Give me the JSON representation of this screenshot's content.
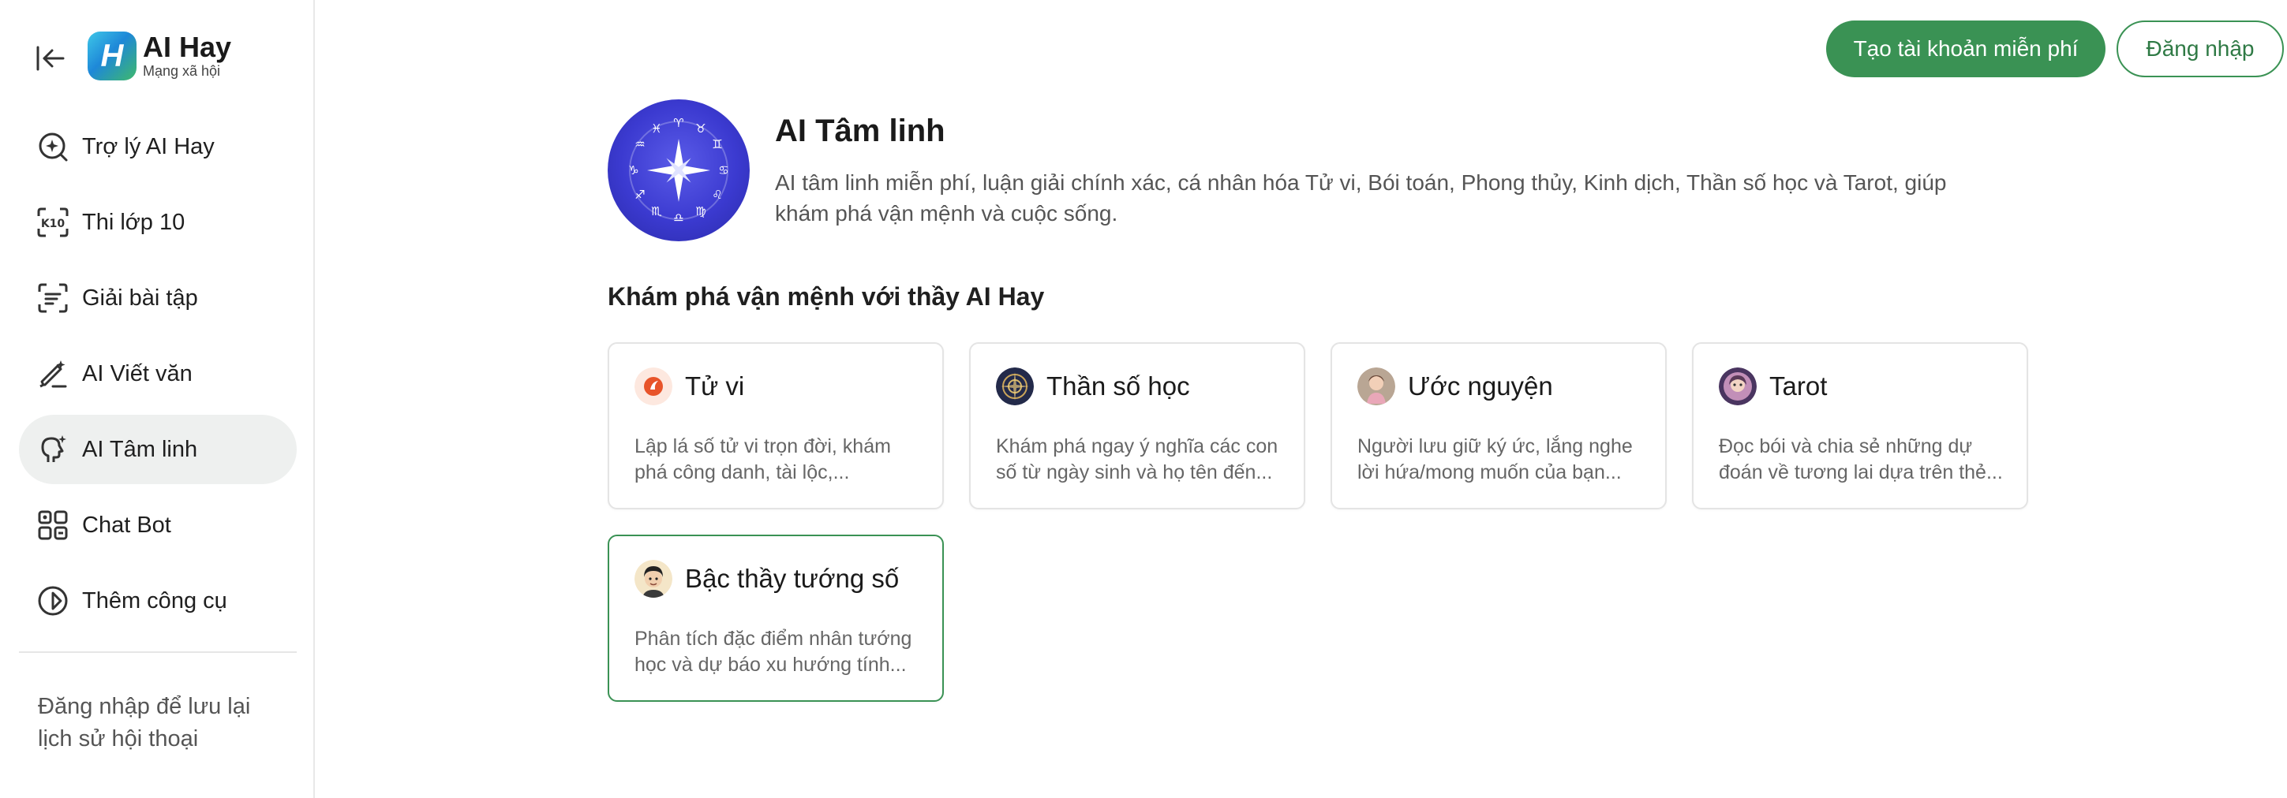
{
  "brand": {
    "name": "AI Hay",
    "tagline": "Mạng xã hội",
    "logo_letter": "H"
  },
  "sidebar": {
    "items": [
      {
        "label": "Trợ lý AI Hay",
        "icon": "ai-assistant-icon",
        "active": false
      },
      {
        "label": "Thi lớp 10",
        "icon": "k10-exam-icon",
        "active": false
      },
      {
        "label": "Giải bài tập",
        "icon": "homework-scan-icon",
        "active": false
      },
      {
        "label": "AI Viết văn",
        "icon": "pen-sparkle-icon",
        "active": false
      },
      {
        "label": "AI Tâm linh",
        "icon": "spiritual-icon",
        "active": true
      },
      {
        "label": "Chat Bot",
        "icon": "apps-grid-icon",
        "active": false
      },
      {
        "label": "Thêm công cụ",
        "icon": "compass-icon",
        "active": false
      }
    ],
    "login_note": "Đăng nhập để lưu lại lịch sử hội thoại"
  },
  "header": {
    "signup_label": "Tạo tài khoản miễn phí",
    "login_label": "Đăng nhập"
  },
  "hero": {
    "title": "AI Tâm linh",
    "description": "AI tâm linh miễn phí, luận giải chính xác, cá nhân hóa Tử vi, Bói toán, Phong thủy, Kinh dịch, Thần số học và Tarot, giúp khám phá vận mệnh và cuộc sống."
  },
  "section": {
    "title": "Khám phá vận mệnh với thầy AI Hay"
  },
  "cards": [
    {
      "title": "Tử vi",
      "description": "Lập lá số tử vi trọn đời, khám phá công danh, tài lộc,...",
      "icon": "tu-vi-avatar"
    },
    {
      "title": "Thần số học",
      "description": "Khám phá ngay ý nghĩa các con số từ ngày sinh và họ tên đến...",
      "icon": "numerology-avatar"
    },
    {
      "title": "Ước nguyện",
      "description": "Người lưu giữ ký ức, lắng nghe lời hứa/mong muốn của bạn...",
      "icon": "wish-avatar"
    },
    {
      "title": "Tarot",
      "description": "Đọc bói và chia sẻ những dự đoán về tương lai dựa trên thẻ...",
      "icon": "tarot-avatar"
    },
    {
      "title": "Bậc thầy tướng số",
      "description": "Phân tích đặc điểm nhân tướng học và dự báo xu hướng tính...",
      "icon": "physiognomy-master-avatar"
    }
  ],
  "colors": {
    "accent": "#3a9254",
    "active_bg": "#eef0ef",
    "hero_purple": "#3b3ad0"
  }
}
